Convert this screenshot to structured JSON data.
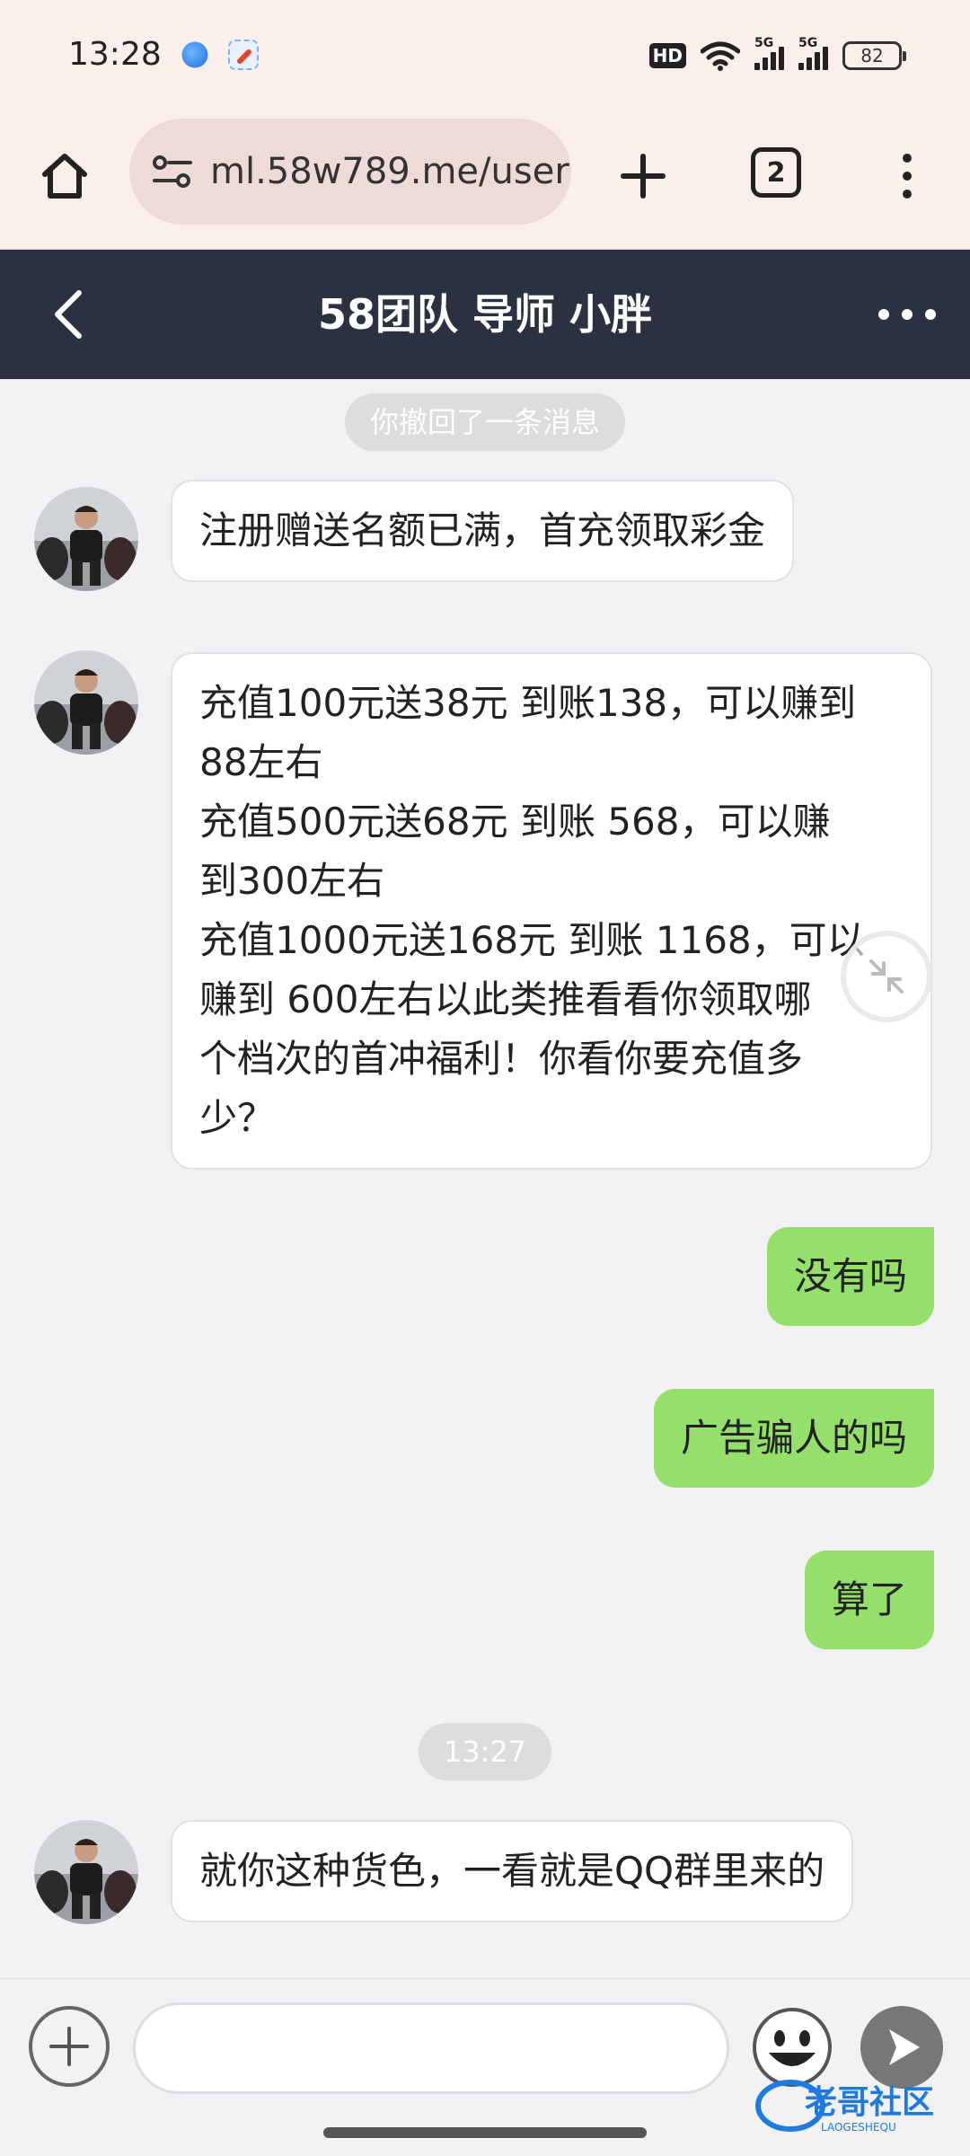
{
  "status_bar": {
    "time": "13:28",
    "network_label_1": "5G",
    "network_label_2": "5G",
    "hd_label": "HD",
    "battery": "82"
  },
  "browser": {
    "url": "ml.58w789.me/user",
    "tab_count": "2"
  },
  "chat": {
    "title": "58团队 导师 小胖",
    "recalled_notice": "你撤回了一条消息",
    "timestamp": "13:27",
    "messages": [
      {
        "side": "in",
        "text": "注册赠送名额已满，首充领取彩金"
      },
      {
        "side": "in",
        "lines": [
          "充值100元送38元 到账138，可以赚到",
          "88左右",
          "充值500元送68元 到账 568，可以赚",
          "到300左右",
          "充值1000元送168元 到账 1168，可以",
          "赚到 600左右以此类推看看你领取哪",
          "个档次的首冲福利！你看你要充值多",
          "少？"
        ]
      },
      {
        "side": "out",
        "text": "没有吗"
      },
      {
        "side": "out",
        "text": "广告骗人的吗"
      },
      {
        "side": "out",
        "text": "算了"
      },
      {
        "side": "in",
        "text": "就你这种货色，一看就是QQ群里来的"
      }
    ]
  },
  "input": {
    "value": "",
    "placeholder": ""
  },
  "watermark": {
    "text": "老哥社区",
    "subtext": "LAOGESHEQU"
  },
  "colors": {
    "header_bg": "#2b3140",
    "browser_bg": "#fbefec",
    "outgoing_bubble": "#95e06b",
    "incoming_bubble": "#ffffff",
    "chat_bg": "#f2f2f5"
  }
}
